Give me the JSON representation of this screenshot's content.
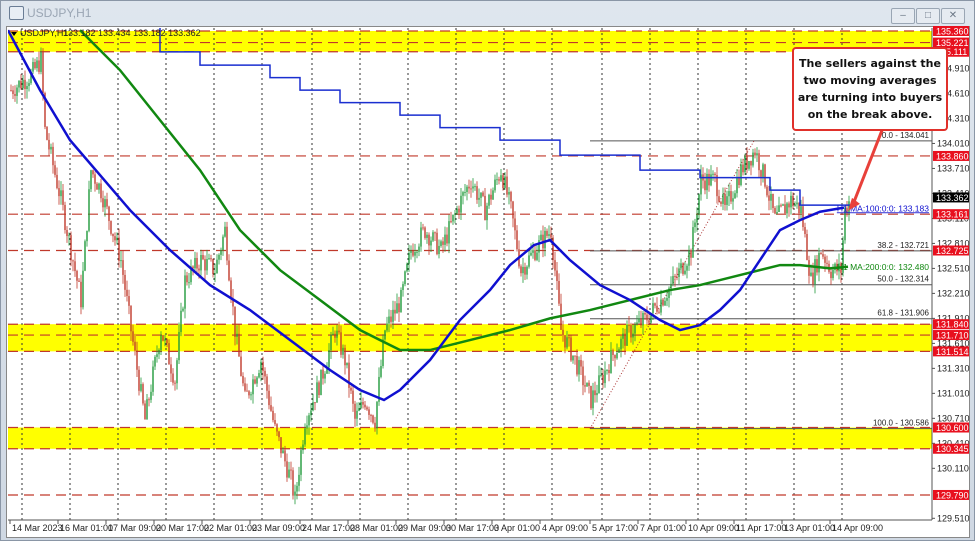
{
  "window": {
    "title": "USDJPY,H1",
    "buttons": [
      "minimize",
      "restore",
      "close"
    ]
  },
  "chart_data": {
    "type": "candlestick",
    "symbol_header": "USDJPY,H1",
    "ohlc_header": "133.182 133.434 133.182 133.362",
    "ylim": [
      129.51,
      135.36
    ],
    "bars_total": 462,
    "y_ticks": [
      "134.910",
      "134.610",
      "134.310",
      "134.010",
      "133.710",
      "133.410",
      "133.110",
      "132.810",
      "132.510",
      "132.210",
      "131.910",
      "131.610",
      "131.310",
      "131.010",
      "130.710",
      "130.410",
      "130.110",
      "129.510"
    ],
    "y_tick_values": [
      134.91,
      134.61,
      134.31,
      134.01,
      133.71,
      133.41,
      133.11,
      132.81,
      132.51,
      132.21,
      131.91,
      131.61,
      131.31,
      131.01,
      130.71,
      130.41,
      130.11,
      129.51
    ],
    "red_levels": [
      {
        "label": "135.360",
        "value": 135.36
      },
      {
        "label": "135.221",
        "value": 135.221
      },
      {
        "label": "135.111",
        "value": 135.111
      },
      {
        "label": "133.860",
        "value": 133.86
      },
      {
        "label": "133.161",
        "value": 133.161
      },
      {
        "label": "132.725",
        "value": 132.725
      },
      {
        "label": "131.840",
        "value": 131.84
      },
      {
        "label": "131.710",
        "value": 131.71
      },
      {
        "label": "131.514",
        "value": 131.514
      },
      {
        "label": "130.600",
        "value": 130.6
      },
      {
        "label": "130.345",
        "value": 130.345
      },
      {
        "label": "129.790",
        "value": 129.79
      }
    ],
    "current_price": {
      "label": "133.362",
      "value": 133.362
    },
    "zones": [
      [
        135.111,
        135.36
      ],
      [
        131.514,
        131.84
      ],
      [
        130.345,
        130.6
      ]
    ],
    "x_labels": [
      {
        "bar": 1,
        "label": "14 Mar 2023"
      },
      {
        "bar": 25,
        "label": "16 Mar 01:00"
      },
      {
        "bar": 49,
        "label": "17 Mar 09:00"
      },
      {
        "bar": 73,
        "label": "20 Mar 17:00"
      },
      {
        "bar": 97,
        "label": "22 Mar 01:00"
      },
      {
        "bar": 121,
        "label": "23 Mar 09:00"
      },
      {
        "bar": 146,
        "label": "24 Mar 17:00"
      },
      {
        "bar": 170,
        "label": "28 Mar 01:00"
      },
      {
        "bar": 194,
        "label": "29 Mar 09:00"
      },
      {
        "bar": 218,
        "label": "30 Mar 17:00"
      },
      {
        "bar": 242,
        "label": "3 Apr 01:00"
      },
      {
        "bar": 266,
        "label": "4 Apr 09:00"
      },
      {
        "bar": 291,
        "label": "5 Apr 17:00"
      },
      {
        "bar": 315,
        "label": "7 Apr 01:00"
      },
      {
        "bar": 339,
        "label": "10 Apr 09:00"
      },
      {
        "bar": 363,
        "label": "11 Apr 17:00"
      },
      {
        "bar": 387,
        "label": "13 Apr 01:00"
      },
      {
        "bar": 411,
        "label": "14 Apr 09:00"
      }
    ],
    "price_path": [
      [
        1,
        134.65
      ],
      [
        11,
        134.83
      ],
      [
        16,
        135.01
      ],
      [
        18,
        134.17
      ],
      [
        26,
        133.33
      ],
      [
        36,
        132.13
      ],
      [
        41,
        133.69
      ],
      [
        46,
        133.45
      ],
      [
        56,
        132.61
      ],
      [
        61,
        131.77
      ],
      [
        68,
        130.69
      ],
      [
        76,
        131.77
      ],
      [
        83,
        131.17
      ],
      [
        88,
        132.37
      ],
      [
        96,
        132.61
      ],
      [
        103,
        132.49
      ],
      [
        108,
        132.97
      ],
      [
        113,
        131.77
      ],
      [
        118,
        130.93
      ],
      [
        126,
        131.41
      ],
      [
        133,
        130.57
      ],
      [
        141,
        129.97
      ],
      [
        143,
        129.73
      ],
      [
        148,
        130.69
      ],
      [
        156,
        131.17
      ],
      [
        163,
        131.77
      ],
      [
        168,
        131.41
      ],
      [
        173,
        130.69
      ],
      [
        178,
        130.93
      ],
      [
        183,
        130.69
      ],
      [
        188,
        131.77
      ],
      [
        196,
        132.13
      ],
      [
        201,
        132.73
      ],
      [
        208,
        132.97
      ],
      [
        216,
        132.73
      ],
      [
        226,
        133.33
      ],
      [
        231,
        133.57
      ],
      [
        238,
        133.21
      ],
      [
        246,
        133.69
      ],
      [
        251,
        133.21
      ],
      [
        256,
        132.49
      ],
      [
        263,
        132.73
      ],
      [
        271,
        132.97
      ],
      [
        276,
        131.77
      ],
      [
        283,
        131.41
      ],
      [
        291,
        130.93
      ],
      [
        296,
        131.17
      ],
      [
        303,
        131.53
      ],
      [
        311,
        131.77
      ],
      [
        318,
        131.89
      ],
      [
        326,
        132.13
      ],
      [
        333,
        132.37
      ],
      [
        341,
        132.73
      ],
      [
        346,
        133.57
      ],
      [
        353,
        133.57
      ],
      [
        358,
        133.21
      ],
      [
        366,
        133.69
      ],
      [
        373,
        133.93
      ],
      [
        378,
        133.57
      ],
      [
        383,
        133.09
      ],
      [
        391,
        133.33
      ],
      [
        396,
        133.21
      ],
      [
        401,
        132.37
      ],
      [
        406,
        132.73
      ],
      [
        411,
        132.49
      ],
      [
        416,
        132.49
      ],
      [
        418,
        133.21
      ],
      [
        421,
        133.36
      ]
    ],
    "ma100": {
      "label": "H1 MA:100:0:0: 133.183",
      "color": "#1010d0",
      "points": [
        [
          0,
          135.37
        ],
        [
          16,
          134.65
        ],
        [
          31,
          134.05
        ],
        [
          46,
          133.63
        ],
        [
          61,
          133.21
        ],
        [
          81,
          132.73
        ],
        [
          101,
          132.31
        ],
        [
          121,
          132.01
        ],
        [
          141,
          131.65
        ],
        [
          161,
          131.29
        ],
        [
          176,
          131.05
        ],
        [
          188,
          130.93
        ],
        [
          196,
          131.05
        ],
        [
          211,
          131.41
        ],
        [
          226,
          131.89
        ],
        [
          241,
          132.25
        ],
        [
          251,
          132.55
        ],
        [
          263,
          132.79
        ],
        [
          271,
          132.85
        ],
        [
          281,
          132.61
        ],
        [
          296,
          132.31
        ],
        [
          311,
          132.13
        ],
        [
          326,
          131.89
        ],
        [
          336,
          131.77
        ],
        [
          346,
          131.83
        ],
        [
          356,
          132.01
        ],
        [
          366,
          132.25
        ],
        [
          376,
          132.61
        ],
        [
          386,
          132.97
        ],
        [
          396,
          133.09
        ],
        [
          406,
          133.19
        ],
        [
          418,
          133.24
        ]
      ]
    },
    "ma200": {
      "label": "H1 MA:200:0:0: 132.480",
      "color": "#118811",
      "points": [
        [
          36,
          135.37
        ],
        [
          56,
          134.89
        ],
        [
          76,
          134.29
        ],
        [
          96,
          133.69
        ],
        [
          116,
          132.97
        ],
        [
          136,
          132.49
        ],
        [
          156,
          132.13
        ],
        [
          176,
          131.77
        ],
        [
          196,
          131.53
        ],
        [
          211,
          131.53
        ],
        [
          231,
          131.65
        ],
        [
          251,
          131.77
        ],
        [
          271,
          131.91
        ],
        [
          291,
          132.01
        ],
        [
          311,
          132.13
        ],
        [
          331,
          132.25
        ],
        [
          346,
          132.31
        ],
        [
          366,
          132.43
        ],
        [
          386,
          132.55
        ],
        [
          396,
          132.55
        ],
        [
          411,
          132.51
        ],
        [
          420,
          132.53
        ]
      ]
    },
    "step_ma": {
      "color": "#1a2fd0",
      "steps": [
        [
          76,
          96,
          135.11
        ],
        [
          96,
          131,
          134.95
        ],
        [
          131,
          146,
          134.8
        ],
        [
          146,
          166,
          134.65
        ],
        [
          166,
          196,
          134.5
        ],
        [
          196,
          216,
          134.35
        ],
        [
          216,
          246,
          134.2
        ],
        [
          246,
          276,
          134.05
        ],
        [
          276,
          316,
          133.87
        ],
        [
          316,
          346,
          133.69
        ],
        [
          346,
          381,
          133.6
        ],
        [
          381,
          396,
          133.45
        ],
        [
          396,
          421,
          133.27
        ]
      ]
    },
    "fib_start_bar": 291,
    "fib_levels": [
      {
        "label": "0.0 - 134.041",
        "value": 134.041
      },
      {
        "label": "38.2 - 132.721",
        "value": 132.721
      },
      {
        "label": "50.0 - 132.314",
        "value": 132.314
      },
      {
        "label": "61.8 - 131.906",
        "value": 131.906
      },
      {
        "label": "100.0 - 130.586",
        "value": 130.586
      }
    ],
    "annotation": "The sellers against the two moving averages are turning into buyers on the break above.",
    "arrow": {
      "from": [
        402,
        134.3
      ],
      "to": [
        420,
        133.2
      ],
      "color": "#e8403a"
    }
  }
}
